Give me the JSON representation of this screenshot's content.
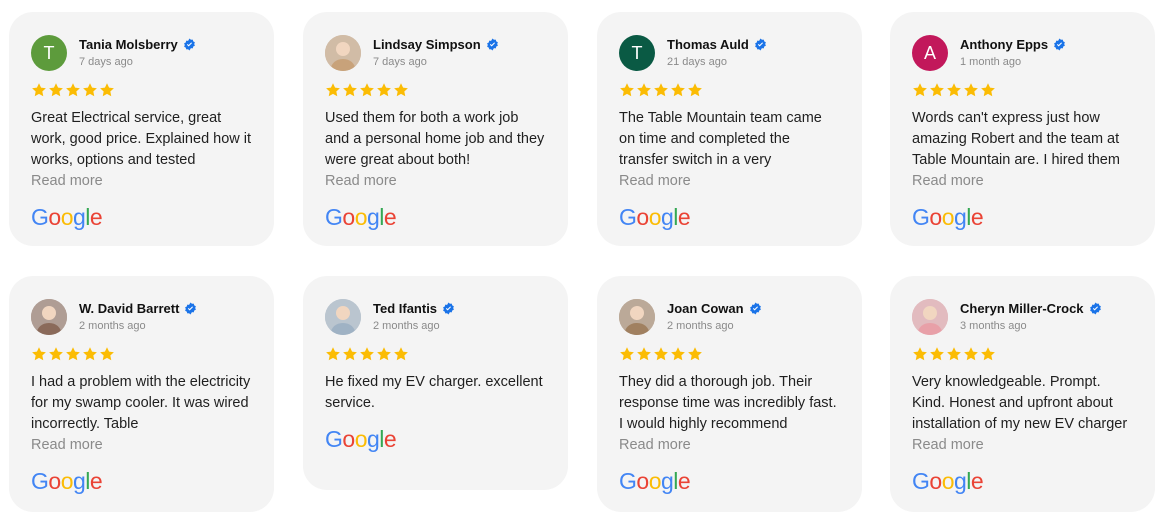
{
  "accent": {
    "verified": "#1a73e8",
    "star": "#fbbc04",
    "read_more": "#8a8a8a"
  },
  "google_logo": {
    "letters": [
      "G",
      "o",
      "o",
      "g",
      "l",
      "e"
    ],
    "colors": [
      "#4285F4",
      "#EA4335",
      "#FBBC05",
      "#4285F4",
      "#34A853",
      "#EA4335"
    ]
  },
  "reviews": [
    {
      "name": "Tania Molsberry",
      "date": "7 days ago",
      "initial": "T",
      "avatar_color": "#5d9b3c",
      "avatar_type": "initial",
      "stars": 5,
      "text": "Great Electrical service, great work, good price. Explained how it works, options and tested",
      "read_more": "Read more"
    },
    {
      "name": "Lindsay Simpson",
      "date": "7 days ago",
      "initial": "",
      "avatar_color": "#c8a27a",
      "avatar_type": "photo",
      "stars": 5,
      "text": "Used them for both a work job and a personal home job and they were great about both!",
      "read_more": "Read more"
    },
    {
      "name": "Thomas Auld",
      "date": "21 days ago",
      "initial": "T",
      "avatar_color": "#0a5a44",
      "avatar_type": "initial",
      "stars": 5,
      "text": "The Table Mountain team came on time and completed the transfer switch in a very",
      "read_more": "Read more"
    },
    {
      "name": "Anthony Epps",
      "date": "1 month ago",
      "initial": "A",
      "avatar_color": "#c2185b",
      "avatar_type": "initial",
      "stars": 5,
      "text": "Words can't express just how amazing Robert and the team at Table Mountain are. I hired them",
      "read_more": "Read more"
    },
    {
      "name": "W. David Barrett",
      "date": "2 months ago",
      "initial": "",
      "avatar_color": "#8a6a5a",
      "avatar_type": "photo",
      "stars": 5,
      "text": "I had a problem with the electricity for my swamp cooler. It was wired incorrectly. Table",
      "read_more": "Read more"
    },
    {
      "name": "Ted Ifantis",
      "date": "2 months ago",
      "initial": "",
      "avatar_color": "#9fb2c4",
      "avatar_type": "photo",
      "stars": 5,
      "text": "He fixed my EV charger. excellent service.",
      "read_more": ""
    },
    {
      "name": "Joan Cowan",
      "date": "2 months ago",
      "initial": "",
      "avatar_color": "#a08060",
      "avatar_type": "photo",
      "stars": 5,
      "text": "They did a thorough job. Their response time was incredibly fast. I would highly recommend",
      "read_more": "Read more"
    },
    {
      "name": "Cheryn Miller-Crock",
      "date": "3 months ago",
      "initial": "",
      "avatar_color": "#e8a0a8",
      "avatar_type": "photo",
      "stars": 5,
      "text": "Very knowledgeable. Prompt. Kind. Honest and upfront about installation of my new EV charger",
      "read_more": "Read more"
    }
  ]
}
